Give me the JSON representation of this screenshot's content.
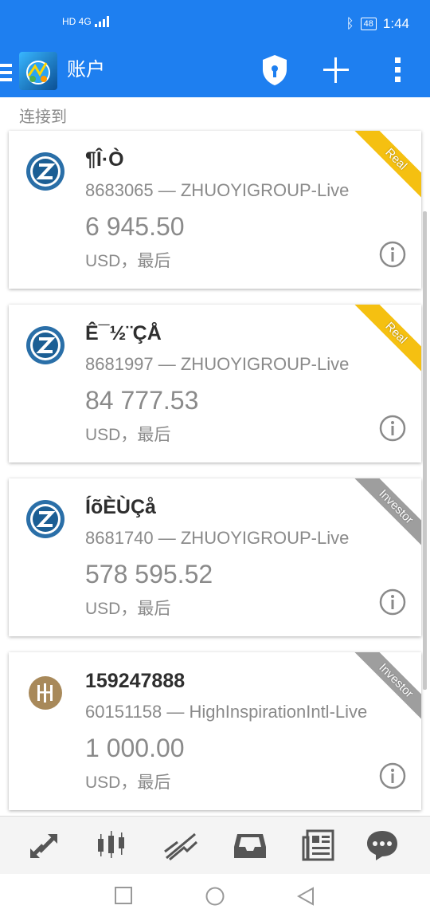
{
  "status_bar": {
    "network_label": "HD 4G",
    "bluetooth_icon": "bluetooth-icon",
    "battery_level": "48",
    "time": "1:44"
  },
  "app_bar": {
    "title": "账户",
    "icons": [
      "menu-icon",
      "app-logo",
      "shield-lock-icon",
      "plus-icon",
      "more-vertical-icon"
    ]
  },
  "section_label": "连接到",
  "accounts": [
    {
      "name": "¶Î·Ò",
      "server_line": "8683065 — ZHUOYIGROUP-Live",
      "balance": "6 945.50",
      "currency_line": "USD，最后",
      "badge": "Real",
      "broker_logo": "zhuoyi-logo"
    },
    {
      "name": "Ê¯½¨ÇÅ",
      "server_line": "8681997 — ZHUOYIGROUP-Live",
      "balance": "84 777.53",
      "currency_line": "USD，最后",
      "badge": "Real",
      "broker_logo": "zhuoyi-logo"
    },
    {
      "name": "ÍõÈÙÇå",
      "server_line": "8681740 — ZHUOYIGROUP-Live",
      "balance": "578 595.52",
      "currency_line": "USD，最后",
      "badge": "Investor",
      "broker_logo": "zhuoyi-logo"
    },
    {
      "name": "159247888",
      "server_line": "60151158 — HighInspirationIntl-Live",
      "balance": "1 000.00",
      "currency_line": "USD，最后",
      "badge": "Investor",
      "broker_logo": "highinspiration-logo"
    }
  ],
  "bottom_nav": [
    "quotes-icon",
    "chart-candles-icon",
    "trade-icon",
    "history-inbox-icon",
    "news-icon",
    "chat-icon"
  ],
  "system_nav": [
    "recents-square-icon",
    "home-circle-icon",
    "back-triangle-icon"
  ],
  "colors": {
    "primary": "#1e7ff0",
    "real_badge": "#f5c011",
    "investor_badge": "#9e9e9e",
    "text_secondary": "#8a8a8a"
  }
}
